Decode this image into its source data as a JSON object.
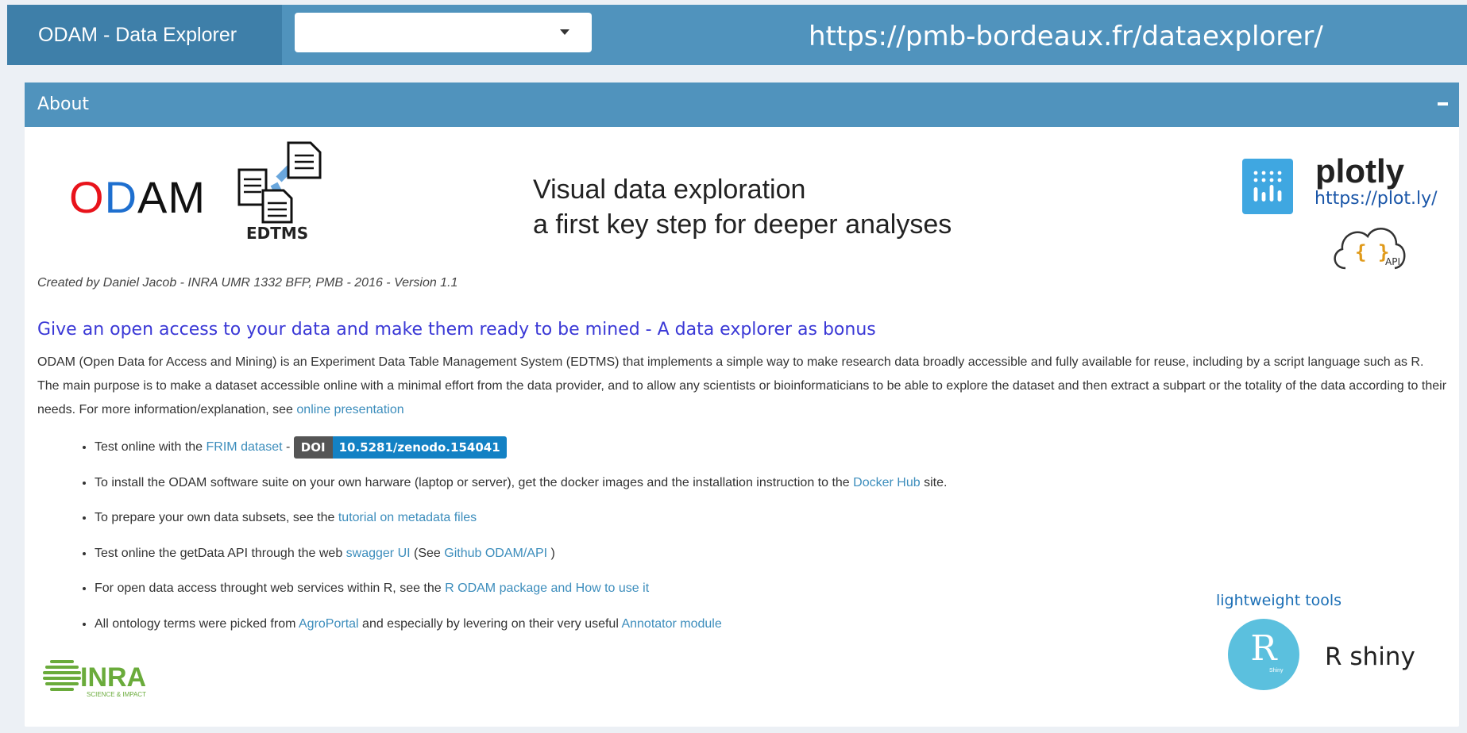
{
  "header": {
    "brand": "ODAM - Data Explorer",
    "dataset_select_value": "",
    "url": "https://pmb-bordeaux.fr/dataexplorer/"
  },
  "about": {
    "title": "About",
    "odam_logo": {
      "o": "O",
      "d": "D",
      "am": "AM"
    },
    "edtms_label": "EDTMS",
    "tagline_line1": "Visual data exploration",
    "tagline_line2": "a first key step for deeper analyses",
    "plotly_name": "plotly",
    "plotly_url": "https://plot.ly/",
    "api_label": "API",
    "api_braces": "{ }",
    "credit": "Created by Daniel Jacob - INRA UMR 1332 BFP, PMB - 2016 - Version 1.1",
    "headline": "Give an open access to your data and make them ready to be mined - A data explorer as bonus",
    "description": "ODAM (Open Data for Access and Mining) is an Experiment Data Table Management System (EDTMS) that implements a simple way to make research data broadly accessible and fully available for reuse, including by a script language such as R. The main purpose is to make a dataset accessible online with a minimal effort from the data provider, and to allow any scientists or bioinformaticians to be able to explore the dataset and then extract a subpart or the totality of the data according to their needs. For more information/explanation, see ",
    "description_link": "online presentation",
    "bullets": {
      "b1_pre": "Test online with the ",
      "b1_link": "FRIM dataset",
      "b1_sep": " - ",
      "doi_key": "DOI",
      "doi_value": "10.5281/zenodo.154041",
      "b2_pre": "To install the ODAM software suite on your own harware (laptop or server), get the docker images and the installation instruction to the ",
      "b2_link": "Docker Hub",
      "b2_post": " site.",
      "b3_pre": "To prepare your own data subsets, see the ",
      "b3_link": "tutorial on metadata files",
      "b4_pre": "Test online the getData API through the web ",
      "b4_link1": "swagger UI",
      "b4_mid": " (See ",
      "b4_link2": "Github ODAM/API",
      "b4_post": " )",
      "b5_pre": "For open data access throught web services within R, see the ",
      "b5_link": "R ODAM package and How to use it",
      "b6_pre": "All ontology terms were picked from ",
      "b6_link1": "AgroPortal",
      "b6_mid": " and especially by levering on their very useful ",
      "b6_link2": "Annotator module"
    },
    "inra_name": "INRA",
    "inra_sub": "SCIENCE & IMPACT",
    "lightweight_tools": "lightweight tools",
    "r_letter": "R",
    "r_logo_sub": "Shiny",
    "rshiny_label": "R shiny"
  },
  "colors": {
    "header_bg": "#5093bd",
    "brand_bg": "#3e7fa9",
    "link": "#3c8dbc",
    "headline": "#3a38d6",
    "odam_o": "#e8131b",
    "odam_d": "#1e6fcf",
    "doi_value_bg": "#1381c4",
    "inra_green": "#6aab3b"
  }
}
